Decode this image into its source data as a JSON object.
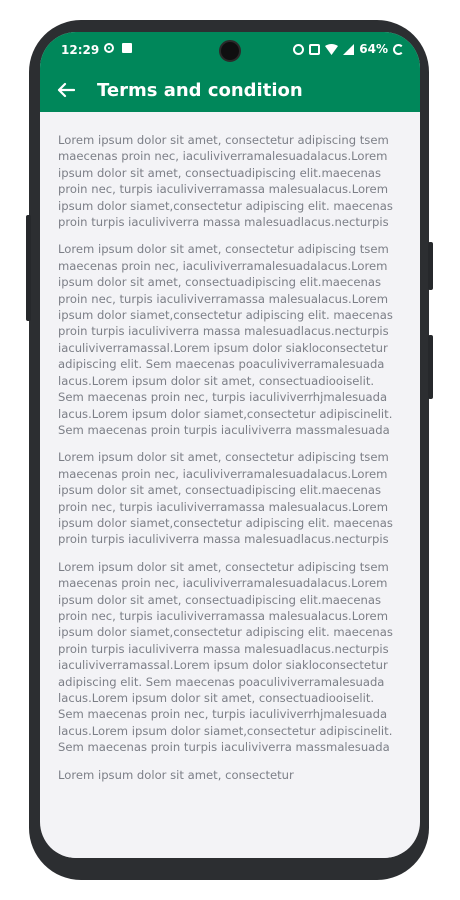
{
  "status_bar": {
    "time": "12:29",
    "battery": "64%"
  },
  "header": {
    "title": "Terms and condition"
  },
  "content": {
    "paragraphs": [
      "Lorem ipsum dolor sit amet, consectetur adipiscing tsem maecenas proin nec, iaculiviverramalesuadalacus.Lorem ipsum dolor sit amet, consectuadipiscing elit.maecenas proin nec, turpis iaculiviverramassa malesualacus.Lorem ipsum dolor siamet,consectetur adipiscing elit. maecenas proin turpis iaculiviverra massa malesuadlacus.necturpis",
      "Lorem ipsum dolor sit amet, consectetur adipiscing tsem maecenas proin nec, iaculiviverramalesuadalacus.Lorem ipsum dolor sit amet, consectuadipiscing elit.maecenas proin nec, turpis iaculiviverramassa malesualacus.Lorem ipsum dolor siamet,consectetur adipiscing elit. maecenas proin turpis iaculiviverra massa malesuadlacus.necturpis iaculiviverramassal.Lorem ipsum dolor siakloconsectetur adipiscing elit. Sem maecenas poaculiviverramalesuada lacus.Lorem ipsum dolor sit amet, consectuadiooiselit. Sem maecenas proin nec, turpis iaculiviverrhjmalesuada lacus.Lorem ipsum dolor siamet,consectetur adipiscinelit. Sem maecenas proin turpis iaculiviverra massmalesuada",
      "Lorem ipsum dolor sit amet, consectetur adipiscing tsem maecenas proin nec, iaculiviverramalesuadalacus.Lorem ipsum dolor sit amet, consectuadipiscing elit.maecenas proin nec, turpis iaculiviverramassa malesualacus.Lorem ipsum dolor siamet,consectetur adipiscing elit. maecenas proin turpis iaculiviverra massa malesuadlacus.necturpis",
      "Lorem ipsum dolor sit amet, consectetur adipiscing tsem maecenas proin nec, iaculiviverramalesuadalacus.Lorem ipsum dolor sit amet, consectuadipiscing elit.maecenas proin nec, turpis iaculiviverramassa malesualacus.Lorem ipsum dolor siamet,consectetur adipiscing elit. maecenas proin turpis iaculiviverra massa malesuadlacus.necturpis iaculiviverramassal.Lorem ipsum dolor siakloconsectetur adipiscing elit. Sem maecenas poaculiviverramalesuada lacus.Lorem ipsum dolor sit amet, consectuadiooiselit. Sem maecenas proin nec, turpis iaculiviverrhjmalesuada lacus.Lorem ipsum dolor siamet,consectetur adipiscinelit. Sem maecenas proin turpis iaculiviverra massmalesuada",
      "Lorem ipsum dolor sit amet, consectetur"
    ]
  },
  "colors": {
    "header_bg": "#00875a",
    "page_bg": "#f3f3f6",
    "text": "#7c7f87"
  },
  "icons": {
    "back": "arrow-left-icon",
    "camera": "camera-cutout",
    "alarm": "alarm-icon",
    "wifi": "wifi-icon",
    "signal": "signal-icon",
    "battery": "battery-saver-icon"
  }
}
